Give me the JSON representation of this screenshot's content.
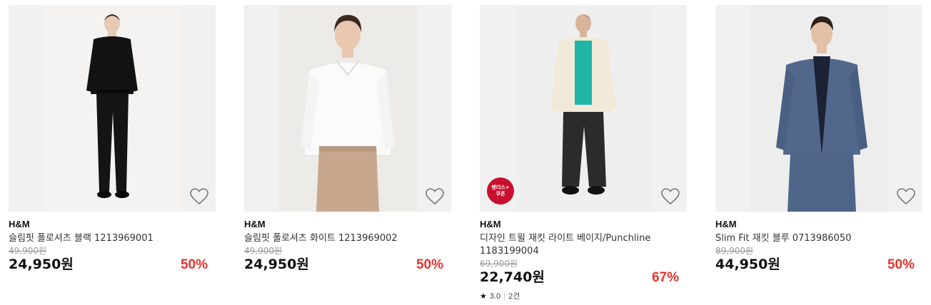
{
  "products": [
    {
      "brand": "H&M",
      "name": "슬림핏 폴로셔츠 블랙 1213969001",
      "original_price": "49,900원",
      "price": "24,950원",
      "discount": "50%",
      "colors": {
        "bg": "#f4f3f1",
        "shirt": "#121212",
        "pants": "#141414",
        "skin": "#e8c9b4",
        "hair": "#2a1f1a"
      }
    },
    {
      "brand": "H&M",
      "name": "슬림핏 폴로셔츠 화이트 1213969002",
      "original_price": "49,900원",
      "price": "24,950원",
      "discount": "50%",
      "colors": {
        "bg": "#ecebe8",
        "shirt": "#fbfbfb",
        "pants": "#c7a88e",
        "skin": "#e9c8b2",
        "hair": "#3a2a20"
      }
    },
    {
      "brand": "H&M",
      "name": "디자인 트윌 재킷 라이트 베이지/Punchline 1183199004",
      "original_price": "69,900원",
      "price": "22,740원",
      "discount": "67%",
      "badge": {
        "line1": "팬더스+",
        "line2": "쿠폰"
      },
      "rating": {
        "score": "3.0",
        "count": "2건"
      },
      "colors": {
        "bg": "#efefef",
        "shirt": "#f1ead8",
        "pants": "#2b2b2b",
        "skin": "#d9b49a",
        "hair": "#1b1b1b",
        "tee": "#1fb6a8"
      }
    },
    {
      "brand": "H&M",
      "name": "Slim Fit 재킷 블루 0713986050",
      "original_price": "89,900원",
      "price": "44,950원",
      "discount": "50%",
      "colors": {
        "bg": "#ededed",
        "shirt": "#51688c",
        "pants": "#4e6589",
        "skin": "#e3c0a8",
        "hair": "#2b211b",
        "tee": "#1c2233"
      }
    }
  ]
}
